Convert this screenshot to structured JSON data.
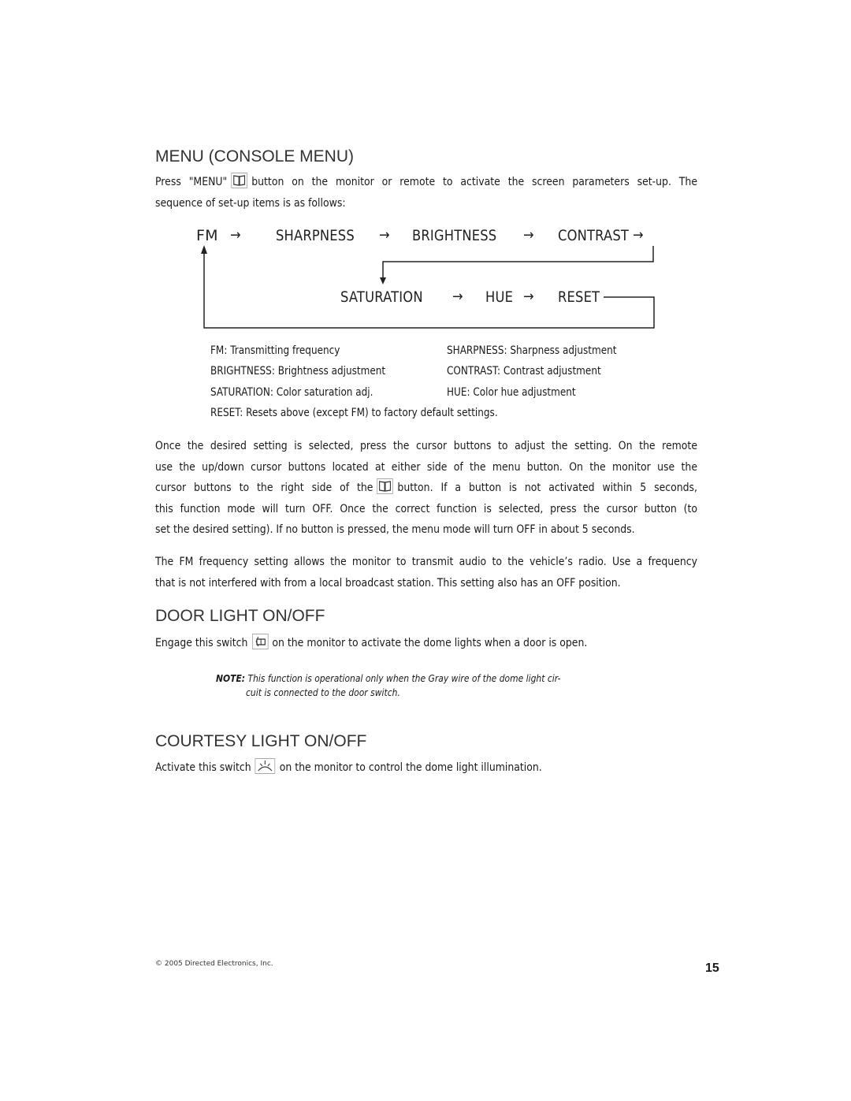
{
  "sections": {
    "menu": {
      "heading": "MENU (CONSOLE MENU)",
      "intro_before_icon": "Press \"MENU\"",
      "intro_icon": "book-menu-icon",
      "intro_after_icon": "button on the monitor or remote to activate the screen parameters set-up. The",
      "intro_line2": "sequence of set-up items is as follows:",
      "flow": {
        "row1": [
          "FM",
          "SHARPNESS",
          "BRIGHTNESS",
          "CONTRAST"
        ],
        "row2": [
          "SATURATION",
          "HUE",
          "RESET"
        ],
        "arrow": "→"
      },
      "definitions": [
        {
          "left": "FM: Transmitting frequency",
          "right": "SHARPNESS: Sharpness adjustment"
        },
        {
          "left": "BRIGHTNESS: Brightness adjustment",
          "right": "CONTRAST: Contrast adjustment"
        },
        {
          "left": "SATURATION: Color saturation adj.",
          "right": "HUE: Color hue adjustment"
        }
      ],
      "reset_definition": "RESET: Resets above (except FM) to factory default settings.",
      "para2": {
        "line1": "Once the desired setting is selected, press the cursor buttons to adjust the setting. On the remote",
        "line2": "use the up/down cursor buttons located at either side of the menu button. On the monitor use the",
        "line3_before_icon": "cursor buttons to the right side of the",
        "line3_after_icon": "button. If a button is not activated within 5 seconds,",
        "line4": "this function mode will turn OFF. Once the correct function is selected, press the cursor button (to",
        "line5": "set the desired setting). If no button is pressed, the menu mode will turn OFF in about 5 seconds."
      },
      "para3": {
        "line1": "The FM frequency setting allows the monitor to transmit audio to the vehicle’s radio. Use a frequency",
        "line2": "that is not interfered with from a local broadcast station. This setting also has an OFF position."
      }
    },
    "door_light": {
      "heading": "DOOR LIGHT ON/OFF",
      "text_before_icon": "Engage this switch",
      "icon": "car-door-icon",
      "text_after_icon": "on the monitor to activate the dome lights when a door is open.",
      "note_label": "NOTE:",
      "note_line1": "This function is operational only when the Gray wire of the dome light cir-",
      "note_line2": "cuit is connected to the door switch."
    },
    "courtesy_light": {
      "heading": "COURTESY LIGHT ON/OFF",
      "text_before_icon": "Activate this switch",
      "icon": "dome-light-icon",
      "text_after_icon": "on the monitor to control the dome light illumination."
    }
  },
  "footer": {
    "copyright": "© 2005 Directed Electronics, Inc.",
    "page_number": "15"
  }
}
